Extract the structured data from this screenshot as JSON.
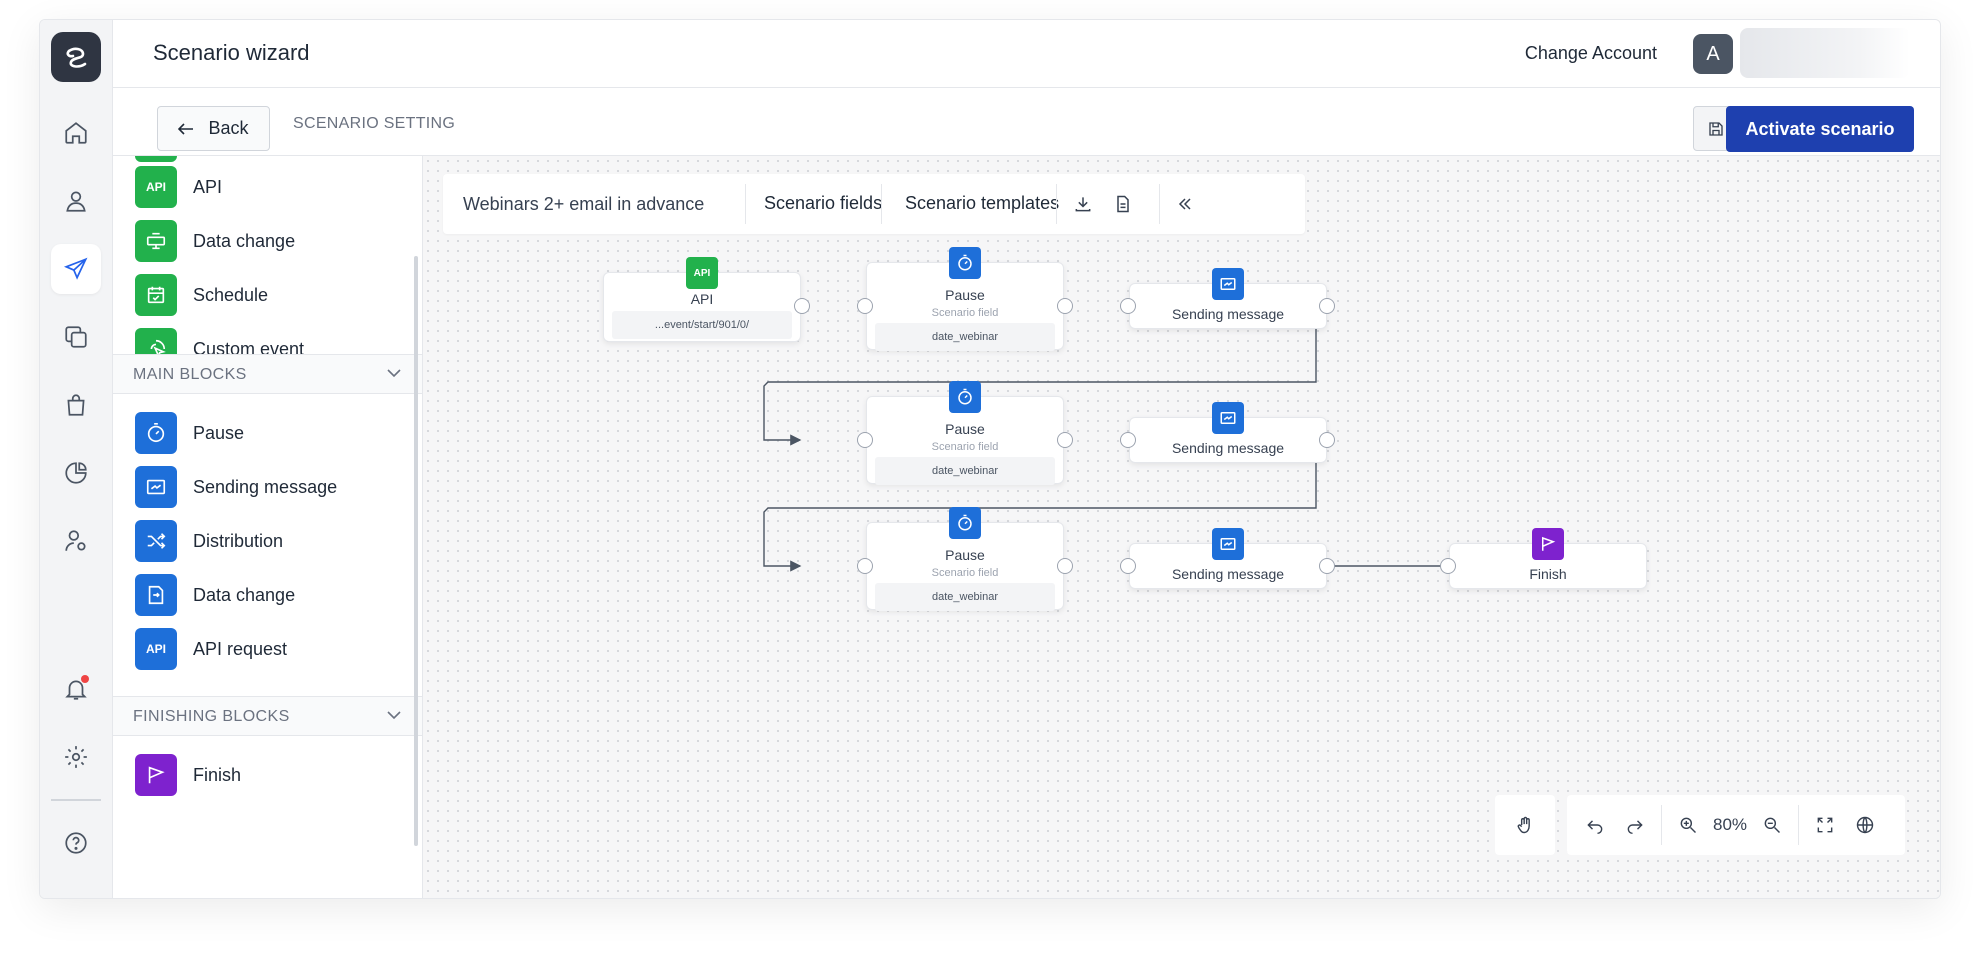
{
  "header": {
    "title": "Scenario wizard",
    "change_account": "Change Account",
    "avatar_initial": "A"
  },
  "subheader": {
    "back_label": "Back",
    "section_label": "SCENARIO SETTING",
    "activate_label": "Activate scenario"
  },
  "rail": {
    "items": [
      "logo-icon",
      "home-icon",
      "user-icon",
      "send-icon",
      "copy-icon",
      "bag-icon",
      "pie-chart-icon",
      "user-settings-icon",
      "bell-icon",
      "gear-icon",
      "help-icon"
    ]
  },
  "sidebar": {
    "start_items": [
      {
        "label": "API",
        "icon": "api-icon",
        "color": "#22b14c"
      },
      {
        "label": "Data change",
        "icon": "data-change-icon",
        "color": "#22b14c"
      },
      {
        "label": "Schedule",
        "icon": "calendar-icon",
        "color": "#22b14c"
      },
      {
        "label": "Custom event",
        "icon": "custom-event-icon",
        "color": "#22b14c"
      }
    ],
    "main_section": "MAIN BLOCKS",
    "main_items": [
      {
        "label": "Pause",
        "icon": "timer-icon",
        "color": "#1e6fd9"
      },
      {
        "label": "Sending message",
        "icon": "message-icon",
        "color": "#1e6fd9"
      },
      {
        "label": "Distribution",
        "icon": "shuffle-icon",
        "color": "#1e6fd9"
      },
      {
        "label": "Data change",
        "icon": "data-change-icon",
        "color": "#1e6fd9"
      },
      {
        "label": "API request",
        "icon": "api-icon",
        "color": "#1e6fd9"
      }
    ],
    "finishing_section": "FINISHING BLOCKS",
    "finishing_items": [
      {
        "label": "Finish",
        "icon": "flag-icon",
        "color": "#7e22ce"
      }
    ]
  },
  "toolbar": {
    "scenario_name": "Webinars 2+ email in advance",
    "fields_label": "Scenario fields",
    "templates_label": "Scenario templates"
  },
  "nodes": {
    "api": {
      "title": "API",
      "badge": "API",
      "field": "...event/start/901/0/"
    },
    "pause1": {
      "title": "Pause",
      "sub": "Scenario field",
      "field": "date_webinar"
    },
    "send1": {
      "title": "Sending message"
    },
    "pause2": {
      "title": "Pause",
      "sub": "Scenario field",
      "field": "date_webinar"
    },
    "send2": {
      "title": "Sending message"
    },
    "pause3": {
      "title": "Pause",
      "sub": "Scenario field",
      "field": "date_webinar"
    },
    "send3": {
      "title": "Sending message"
    },
    "finish": {
      "title": "Finish"
    }
  },
  "zoom": "80%",
  "colors": {
    "accent": "#1e40af",
    "start_block": "#22b14c",
    "main_block": "#1e6fd9",
    "finish_block": "#7e22ce"
  }
}
